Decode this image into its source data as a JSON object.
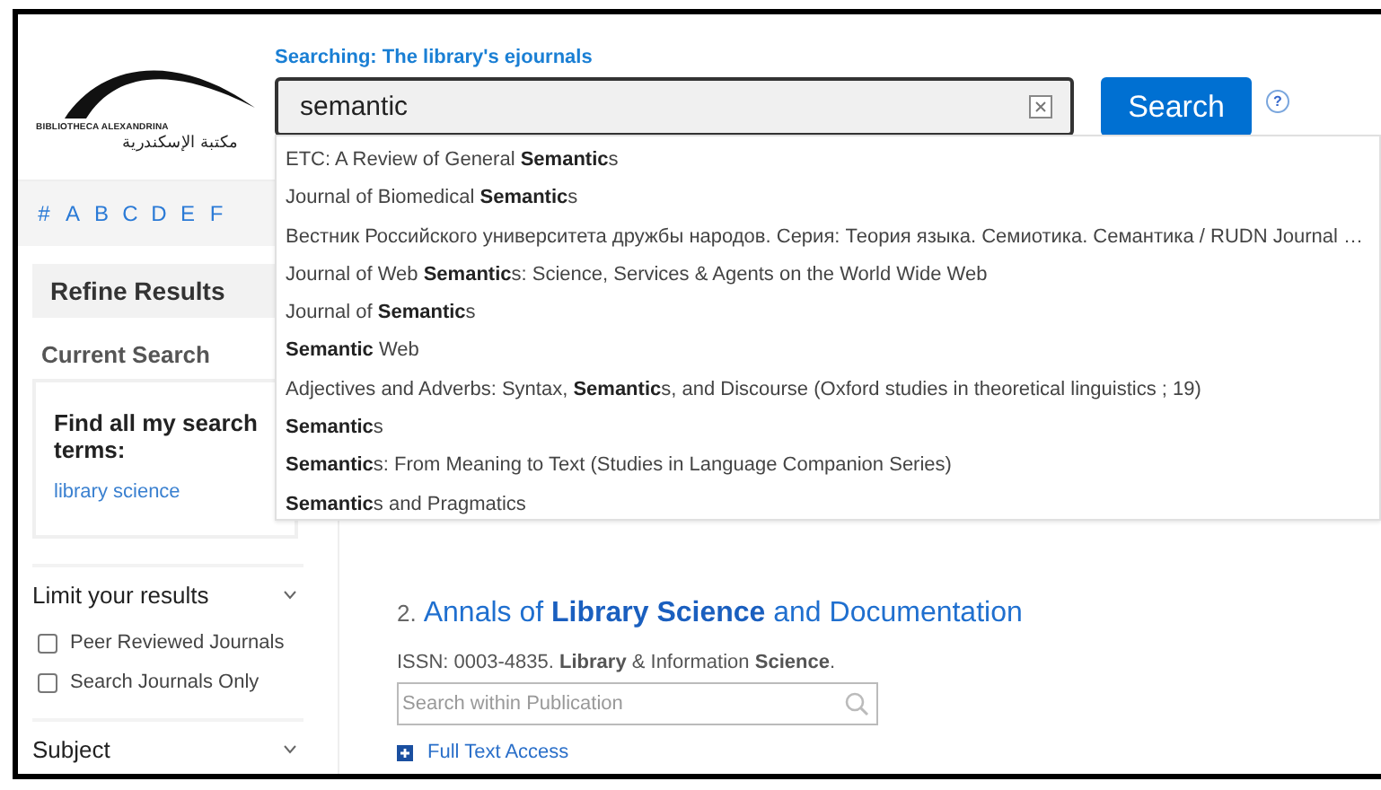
{
  "header": {
    "logo": {
      "latin": "BIBLIOTHECA ALEXANDRINA",
      "arabic": "مكتبة الإسكندرية"
    },
    "scope_label": "Searching: The library's ejournals",
    "search": {
      "value": "semantic"
    },
    "search_button": "Search",
    "help": "?"
  },
  "alphabet": [
    "#",
    "A",
    "B",
    "C",
    "D",
    "E",
    "F"
  ],
  "suggestions": [
    "ETC: A Review of General **Semantic**s",
    "Journal of Biomedical **Semantic**s",
    "Вестник Российского университета дружбы народов. Серия: Теория языка. Семиотика. Семантика / RUDN Journal …",
    "Journal of Web **Semantic**s: Science, Services & Agents on the World Wide Web",
    "Journal of **Semantic**s",
    "**Semantic** Web",
    "Adjectives and Adverbs: Syntax, **Semantic**s, and Discourse (Oxford studies in theoretical linguistics ; 19)",
    "**Semantic**s",
    "**Semantic**s: From Meaning to Text (Studies in Language Companion Series)",
    "**Semantic**s and Pragmatics"
  ],
  "sidebar": {
    "title": "Refine Results",
    "current_search": {
      "heading": "Current Search",
      "label": "Find all my search terms:",
      "term": "library science"
    },
    "sections": [
      {
        "title": "Limit your results",
        "options": [
          {
            "label": "Peer Reviewed Journals",
            "checked": false
          },
          {
            "label": "Search Journals Only",
            "checked": false
          }
        ]
      },
      {
        "title": "Subject"
      }
    ]
  },
  "results": [
    {
      "number": "2.",
      "title": "Annals of **Library Science** and Documentation",
      "issn_line": "ISSN: 0003-4835. **Library** & Information **Science**.",
      "search_placeholder": "Search within Publication",
      "link": "Full Text Access"
    }
  ]
}
